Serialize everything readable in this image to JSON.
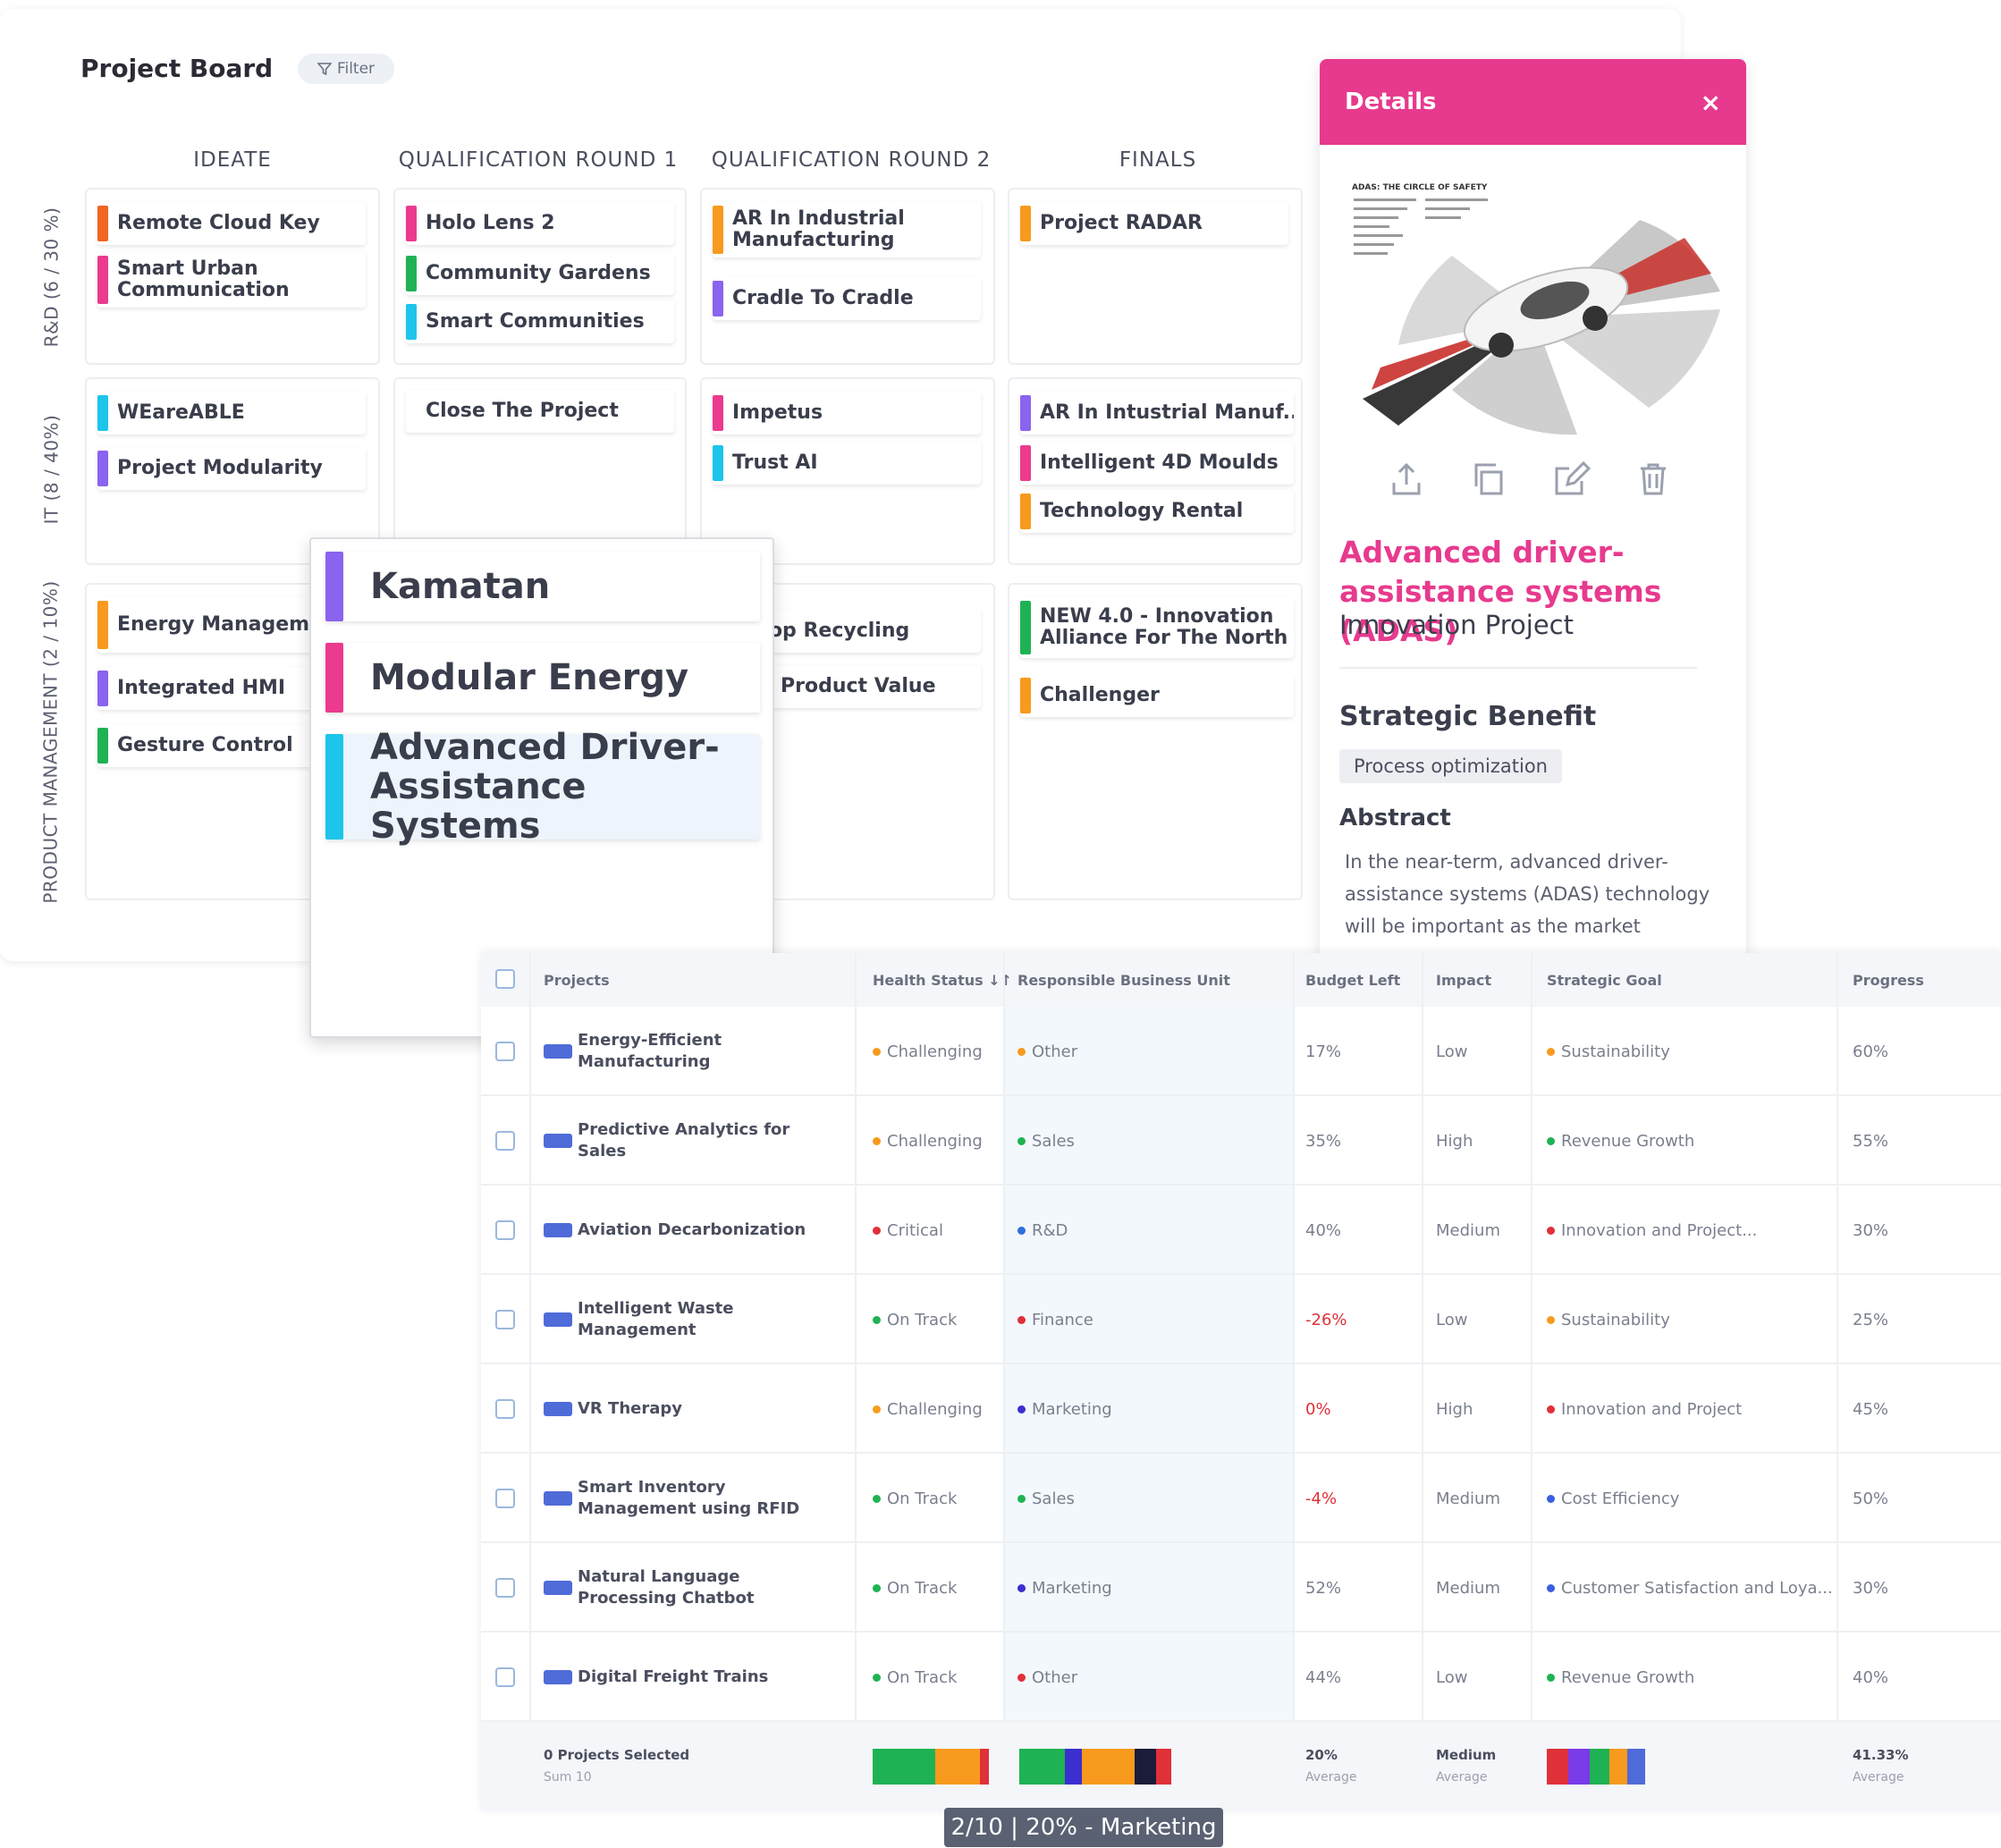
{
  "board": {
    "title": "Project Board",
    "filter_label": "Filter",
    "columns": [
      "IDEATE",
      "QUALIFICATION ROUND 1",
      "QUALIFICATION ROUND 2",
      "FINALS"
    ],
    "rows": [
      "R&D (6 / 30 %)",
      "IT (8 / 40%)",
      "PRODUCT MANAGEMENT (2 / 10%)"
    ],
    "cards": {
      "rd_ideate": [
        "Remote Cloud Key",
        "Smart Urban Communication"
      ],
      "rd_q1": [
        "Holo Lens 2",
        "Community Gardens",
        "Smart Communities"
      ],
      "rd_q2": [
        "AR In Industrial Manufacturing",
        "Cradle To Cradle"
      ],
      "rd_finals": [
        "Project RADAR"
      ],
      "it_ideate": [
        "WEareABLE",
        "Project Modularity"
      ],
      "it_q1": [
        "Close The Project"
      ],
      "it_q2": [
        "Impetus",
        "Trust AI"
      ],
      "it_finals": [
        "AR In Intustrial Manuf...",
        "Intelligent 4D Moulds",
        "Technology Rental"
      ],
      "pm_ideate": [
        "Energy Management",
        "Integrated HMI",
        "Gesture Control"
      ],
      "pm_q2": [
        "yprop Recycling",
        "end Product Value"
      ],
      "pm_finals": [
        "NEW 4.0 - Innovation Alliance For The North",
        "Challenger"
      ]
    },
    "colors": {
      "orange": "#f79a1e",
      "deep_orange": "#f26522",
      "pink": "#ec3a8e",
      "green": "#1fb254",
      "cyan": "#1dc5ea",
      "purple": "#8a63ee"
    }
  },
  "drag": {
    "items": [
      "Kamatan",
      "Modular Energy",
      "Advanced Driver-Assistance Systems"
    ]
  },
  "details": {
    "title": "Details",
    "close": "×",
    "image_caption": "ADAS: THE CIRCLE OF SAFETY",
    "actions": [
      "share-icon",
      "copy-icon",
      "edit-icon",
      "delete-icon"
    ],
    "name": "Advanced driver-assistance systems (ADAS)",
    "type": "Innovation Project",
    "strategic_benefit_heading": "Strategic Benefit",
    "strategic_benefit": "Process optimization",
    "abstract_heading": "Abstract",
    "abstract": "In the near-term, advanced driver-assistance systems (ADAS) technology will be important as the market"
  },
  "table": {
    "headers": [
      "Projects",
      "Health Status ↓↑",
      "Responsible Business Unit",
      "Budget Left",
      "Impact",
      "Strategic Goal",
      "Progress"
    ],
    "rows": [
      {
        "project": "Energy-Efficient Manufacturing",
        "health": "Challenging",
        "health_color": "#f79a1e",
        "unit": "Other",
        "unit_color": "#f79a1e",
        "budget": "17%",
        "budget_neg": false,
        "impact": "Low",
        "goal": "Sustainability",
        "goal_color": "#f79a1e",
        "progress": "60%"
      },
      {
        "project": "Predictive Analytics for Sales",
        "health": "Challenging",
        "health_color": "#f79a1e",
        "unit": "Sales",
        "unit_color": "#1fb254",
        "budget": "35%",
        "budget_neg": false,
        "impact": "High",
        "goal": "Revenue Growth",
        "goal_color": "#1fb254",
        "progress": "55%"
      },
      {
        "project": "Aviation Decarbonization",
        "health": "Critical",
        "health_color": "#e0303a",
        "unit": "R&D",
        "unit_color": "#2d6fe0",
        "budget": "40%",
        "budget_neg": false,
        "impact": "Medium",
        "goal": "Innovation and Project...",
        "goal_color": "#e0303a",
        "progress": "30%"
      },
      {
        "project": "Intelligent Waste Management",
        "health": "On Track",
        "health_color": "#1fb254",
        "unit": "Finance",
        "unit_color": "#e0303a",
        "budget": "-26%",
        "budget_neg": true,
        "impact": "Low",
        "goal": "Sustainability",
        "goal_color": "#f79a1e",
        "progress": "25%"
      },
      {
        "project": "VR Therapy",
        "health": "Challenging",
        "health_color": "#f79a1e",
        "unit": "Marketing",
        "unit_color": "#3b2fd0",
        "budget": "0%",
        "budget_neg": true,
        "impact": "High",
        "goal": "Innovation and Project",
        "goal_color": "#e0303a",
        "progress": "45%"
      },
      {
        "project": "Smart Inventory Management using RFID",
        "health": "On Track",
        "health_color": "#1fb254",
        "unit": "Sales",
        "unit_color": "#1fb254",
        "budget": "-4%",
        "budget_neg": true,
        "impact": "Medium",
        "goal": "Cost Efficiency",
        "goal_color": "#3b5fe0",
        "progress": "50%"
      },
      {
        "project": "Natural Language Processing Chatbot",
        "health": "On Track",
        "health_color": "#1fb254",
        "unit": "Marketing",
        "unit_color": "#3b2fd0",
        "budget": "52%",
        "budget_neg": false,
        "impact": "Medium",
        "goal": "Customer Satisfaction and Loya...",
        "goal_color": "#3b5fe0",
        "progress": "30%"
      },
      {
        "project": "Digital Freight Trains",
        "health": "On Track",
        "health_color": "#1fb254",
        "unit": "Other",
        "unit_color": "#e0303a",
        "budget": "44%",
        "budget_neg": false,
        "impact": "Low",
        "goal": "Revenue Growth",
        "goal_color": "#1fb254",
        "progress": "40%"
      }
    ],
    "footer": {
      "selected": "0 Projects Selected",
      "sum": "Sum 10",
      "budget": "20%",
      "budget_sub": "Average",
      "impact": "Medium",
      "impact_sub": "Average",
      "progress": "41.33%",
      "progress_sub": "Average"
    },
    "tooltip": "2/10 | 20% - Marketing"
  }
}
